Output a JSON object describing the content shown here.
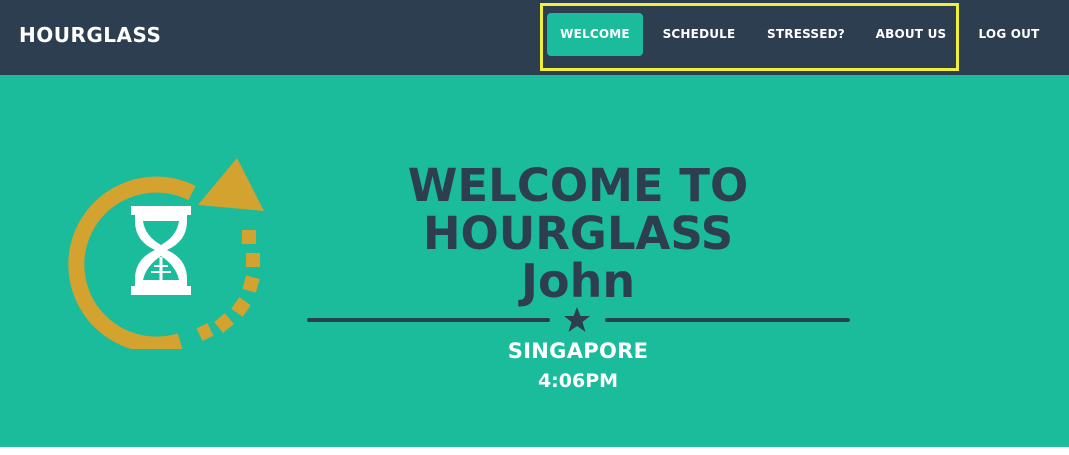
{
  "brand": "HOURGLASS",
  "nav": {
    "items": [
      {
        "label": "WELCOME",
        "active": true
      },
      {
        "label": "SCHEDULE",
        "active": false
      },
      {
        "label": "STRESSED?",
        "active": false
      },
      {
        "label": "ABOUT US",
        "active": false
      },
      {
        "label": "LOG OUT",
        "active": false
      }
    ]
  },
  "hero": {
    "title_line1": "WELCOME TO",
    "title_line2": "HOURGLASS",
    "user_name": "John",
    "city": "SINGAPORE",
    "time": "4:06PM",
    "logo_icon": "hourglass-refresh-icon",
    "divider_icon": "star-icon"
  },
  "colors": {
    "navbar_bg": "#2c3e50",
    "accent": "#1abc9c",
    "logo_arrow": "#d4a22e",
    "highlight_box": "#f0f03a",
    "text_dark": "#2c3e50",
    "text_light": "#ffffff"
  }
}
